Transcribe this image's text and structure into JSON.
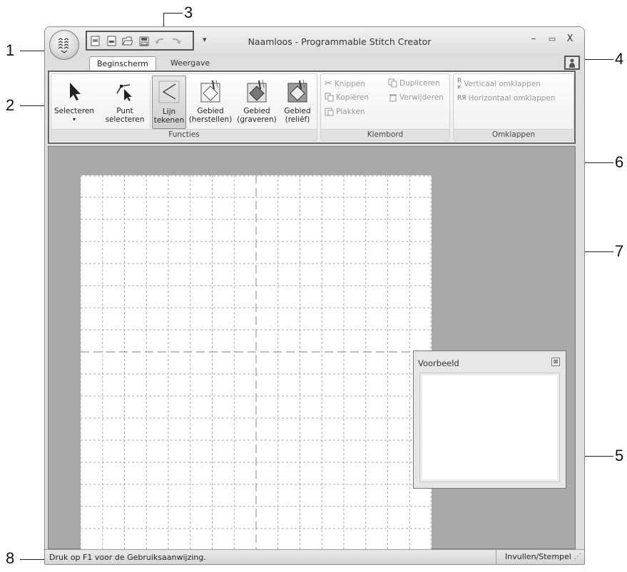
{
  "window": {
    "title": "Naamloos - Programmable Stitch Creator",
    "minimize": "–",
    "maximize": "▭",
    "close": "X"
  },
  "quick_access": [
    "new-doc",
    "new-template",
    "open",
    "save",
    "undo",
    "redo"
  ],
  "quick_access_dropdown": "▾",
  "tabs": [
    {
      "label": "Beginscherm",
      "active": true
    },
    {
      "label": "Weergave",
      "active": false
    }
  ],
  "ribbon": {
    "groups": {
      "functions": {
        "label": "Functies",
        "buttons": {
          "select": "Selecteren",
          "select_arrow": "▾",
          "point_select_1": "Punt",
          "point_select_2": "selecteren",
          "line_draw_1": "Lijn",
          "line_draw_2": "tekenen",
          "area_restore_1": "Gebied",
          "area_restore_2": "(herstellen)",
          "area_engrave_1": "Gebied",
          "area_engrave_2": "(graveren)",
          "area_relief_1": "Gebied",
          "area_relief_2": "(reliëf)"
        }
      },
      "clipboard": {
        "label": "Klembord",
        "buttons": {
          "cut": "Knippen",
          "duplicate": "Dupliceren",
          "copy": "Kopiëren",
          "delete": "Verwijderen",
          "paste": "Plakken"
        }
      },
      "flip": {
        "label": "Omklappen",
        "buttons": {
          "vertical": "Verticaal omklappen",
          "horizontal": "Horizontaal omklappen"
        }
      }
    }
  },
  "preview": {
    "title": "Voorbeeld",
    "close": "⊠"
  },
  "status": {
    "text": "Druk op F1 voor de Gebruiksaanwijzing.",
    "mode": "Invullen/Stempel"
  },
  "callouts": {
    "n1": "1",
    "n2": "2",
    "n3": "3",
    "n4": "4",
    "n5": "5",
    "n6": "6",
    "n7": "7",
    "n8": "8"
  }
}
